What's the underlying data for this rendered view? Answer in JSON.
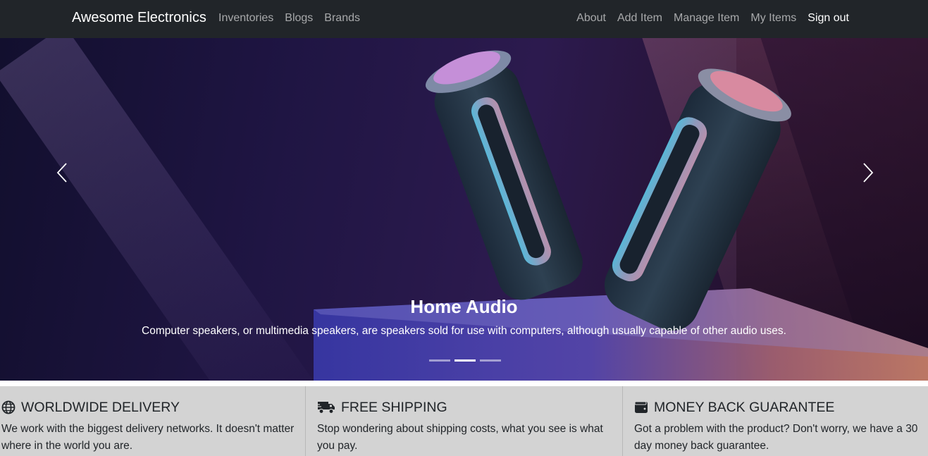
{
  "navbar": {
    "brand": "Awesome Electronics",
    "left_links": [
      "Inventories",
      "Blogs",
      "Brands"
    ],
    "right_links": [
      "About",
      "Add Item",
      "Manage Item",
      "My Items"
    ],
    "sign_out": "Sign out",
    "colors": {
      "background": "#212529",
      "link": "rgba(255,255,255,0.6)",
      "active_link": "#ffffff"
    }
  },
  "carousel": {
    "slide_title": "Home Audio",
    "slide_text": "Computer speakers, or multimedia speakers, are speakers sold for use with computers, although usually capable of other audio uses.",
    "prev_icon": "chevron-left-icon",
    "next_icon": "chevron-right-icon",
    "slide_count": 3,
    "active_slide": 2
  },
  "features": [
    {
      "icon": "globe-icon",
      "title": "WORLDWIDE DELIVERY",
      "text": "We work with the biggest delivery networks. It doesn't matter where in the world you are."
    },
    {
      "icon": "shipping-truck-icon",
      "title": "FREE SHIPPING",
      "text": "Stop wondering about shipping costs, what you see is what you pay."
    },
    {
      "icon": "wallet-icon",
      "title": "MONEY BACK GUARANTEE",
      "text": "Got a problem with the product? Don't worry, we have a 30 day money back guarantee."
    }
  ],
  "colors": {
    "features_background": "#d3d3d3",
    "text": "#212529"
  }
}
